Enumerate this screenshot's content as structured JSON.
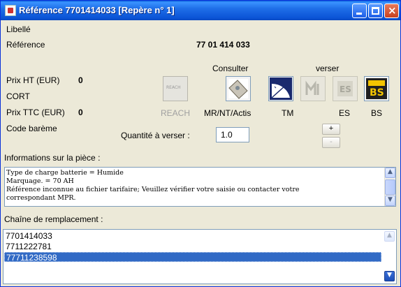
{
  "window": {
    "title": "Référence 7701414033 [Repère n° 1]"
  },
  "labels": {
    "libelle": "Libellé",
    "reference": "Référence",
    "reference_value": "77 01 414 033",
    "prix_ht": "Prix HT (EUR)",
    "prix_ht_value": "0",
    "cort": "CORT",
    "prix_ttc": "Prix TTC (EUR)",
    "prix_ttc_value": "0",
    "code_bareme": "Code barème",
    "consulter": "Consulter",
    "verser": "verser",
    "quantite": "Quantité à verser :",
    "informations": "Informations sur la pièce :",
    "chaine": "Chaîne de remplacement :"
  },
  "icons": {
    "reach": {
      "label": "REACH",
      "icon": "reach-icon",
      "enabled": false
    },
    "mrntactis": {
      "label": "MR/NT/Actis",
      "icon": "document-pin-icon",
      "enabled": true
    },
    "tm": {
      "label": "TM",
      "icon": "clock-gauge-icon",
      "enabled": true
    },
    "verser1": {
      "label": "",
      "icon": "crm-icon",
      "enabled": false
    },
    "es": {
      "label": "ES",
      "icon": "es-icon",
      "enabled": false
    },
    "bs": {
      "label": "BS",
      "icon": "bs-icon",
      "enabled": true
    }
  },
  "quantity": {
    "value": "1.0",
    "plus": "+",
    "minus": "-"
  },
  "info_text": [
    "Type de charge batterie = Humide",
    "Marquage. = 70 AH",
    "Référence inconnue au fichier tarifaire; Veuillez vérifier votre saisie ou contacter votre",
    "correspondant MPR."
  ],
  "replacement_chain": [
    {
      "value": "7701414033",
      "selected": false
    },
    {
      "value": "7711222781",
      "selected": false
    },
    {
      "value": "77711238598",
      "selected": true
    }
  ],
  "colors": {
    "titlebar": "#0b54d6",
    "selection": "#316ac5",
    "window_bg": "#ece9d8"
  }
}
